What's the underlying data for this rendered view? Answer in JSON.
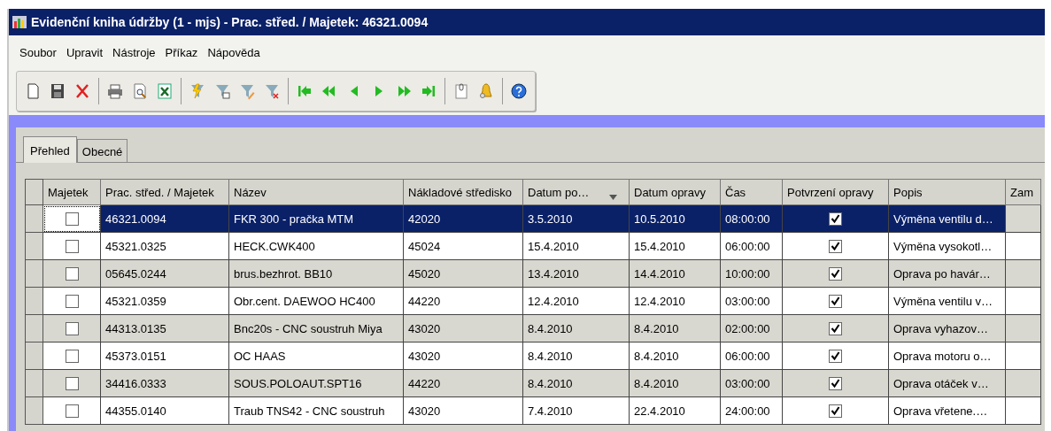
{
  "window": {
    "title": "Evidenční kniha údržby (1 - mjs) - Prac. střed. / Majetek: 46321.0094"
  },
  "menu": [
    "Soubor",
    "Upravit",
    "Nástroje",
    "Příkaz",
    "Nápověda"
  ],
  "tabs": [
    {
      "label": "Přehled",
      "selected": true
    },
    {
      "label": "Obecné",
      "selected": false
    }
  ],
  "table": {
    "columns": [
      {
        "label": "Majetek",
        "kind": "check",
        "sorted": false
      },
      {
        "label": "Prac. střed. / Majetek",
        "kind": "text",
        "sorted": false
      },
      {
        "label": "Název",
        "kind": "text",
        "sorted": false
      },
      {
        "label": "Nákladové středisko",
        "kind": "text",
        "sorted": false
      },
      {
        "label": "Datum po…",
        "kind": "text",
        "sorted": true
      },
      {
        "label": "Datum opravy",
        "kind": "text",
        "sorted": false
      },
      {
        "label": "Čas",
        "kind": "text",
        "sorted": false
      },
      {
        "label": "Potvrzení opravy",
        "kind": "check",
        "sorted": false
      },
      {
        "label": "Popis",
        "kind": "text",
        "sorted": false
      },
      {
        "label": "Zam",
        "kind": "text",
        "sorted": false
      }
    ],
    "rows": [
      {
        "selected": true,
        "cells": [
          {
            "checked": false
          },
          "46321.0094",
          "FKR 300 - pračka MTM",
          "42020",
          "3.5.2010",
          "10.5.2010",
          "08:00:00",
          {
            "checked": true
          },
          "Výměna ventilu d…",
          ""
        ]
      },
      {
        "selected": false,
        "cells": [
          {
            "checked": false
          },
          "45321.0325",
          "HECK.CWK400",
          "45024",
          "15.4.2010",
          "15.4.2010",
          "06:00:00",
          {
            "checked": true
          },
          "Výměna vysokotl…",
          ""
        ]
      },
      {
        "selected": false,
        "cells": [
          {
            "checked": false
          },
          "05645.0244",
          "brus.bezhrot. BB10",
          "45020",
          "13.4.2010",
          "14.4.2010",
          "10:00:00",
          {
            "checked": true
          },
          "Oprava po havár…",
          ""
        ]
      },
      {
        "selected": false,
        "cells": [
          {
            "checked": false
          },
          "45321.0359",
          "Obr.cent. DAEWOO HC400",
          "44220",
          "12.4.2010",
          "12.4.2010",
          "03:00:00",
          {
            "checked": true
          },
          "Výměna ventilu v…",
          ""
        ]
      },
      {
        "selected": false,
        "cells": [
          {
            "checked": false
          },
          "44313.0135",
          "Bnc20s - CNC soustruh Miya",
          "43020",
          "8.4.2010",
          "8.4.2010",
          "02:00:00",
          {
            "checked": true
          },
          "Oprava vyhazov…",
          ""
        ]
      },
      {
        "selected": false,
        "cells": [
          {
            "checked": false
          },
          "45373.0151",
          "OC HAAS",
          "43020",
          "8.4.2010",
          "8.4.2010",
          "06:00:00",
          {
            "checked": true
          },
          "Oprava motoru o…",
          ""
        ]
      },
      {
        "selected": false,
        "cells": [
          {
            "checked": false
          },
          "34416.0333",
          "SOUS.POLOAUT.SPT16",
          "44220",
          "8.4.2010",
          "8.4.2010",
          "03:00:00",
          {
            "checked": true
          },
          "Oprava otáček v…",
          ""
        ]
      },
      {
        "selected": false,
        "cells": [
          {
            "checked": false
          },
          "44355.0140",
          "Traub TNS42 - CNC soustruh",
          "43020",
          "7.4.2010",
          "22.4.2010",
          "24:00:00",
          {
            "checked": true
          },
          "Oprava vřetene.…",
          ""
        ]
      }
    ]
  }
}
